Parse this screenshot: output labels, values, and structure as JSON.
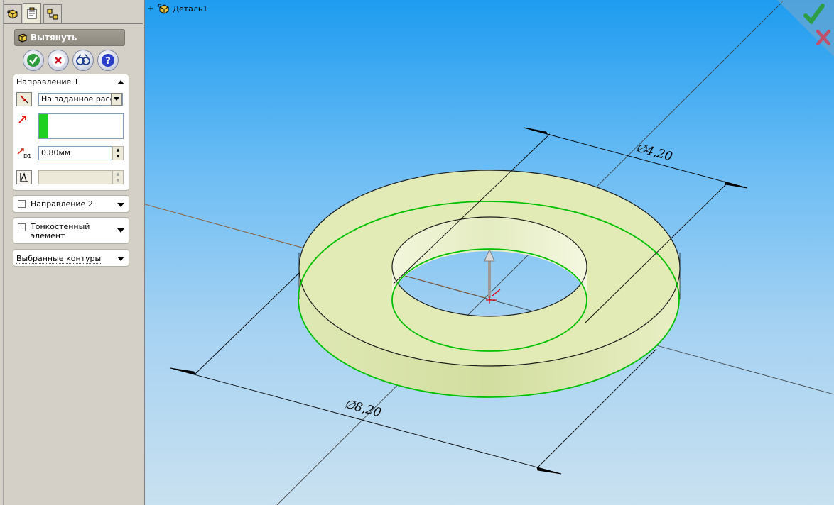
{
  "feature_manager": {
    "tabs": [
      {
        "icon": "feature-tree-icon"
      },
      {
        "icon": "property-manager-icon"
      },
      {
        "icon": "configuration-manager-icon"
      }
    ],
    "feature_title": "Вытянуть",
    "actions": [
      {
        "icon": "ok-check-icon"
      },
      {
        "icon": "cancel-x-icon"
      },
      {
        "icon": "preview-glasses-icon"
      },
      {
        "icon": "help-question-icon"
      }
    ]
  },
  "direction1": {
    "title": "Направление 1",
    "end_condition": "На заданное расст",
    "depth_value": "0.80мм",
    "draft_value": ""
  },
  "direction2": {
    "title": "Направление 2",
    "checked": false
  },
  "thin_feature": {
    "title": "Тонкостенный элемент",
    "checked": false
  },
  "selected_contours": {
    "title": "Выбранные контуры"
  },
  "viewport": {
    "tree_root": "Деталь1",
    "dimension_inner": "∅4,20",
    "dimension_outer": "∅8,20",
    "colors": {
      "sky_top": "#1e9cf0",
      "sky_bottom": "#c9e1f0",
      "part_fill": "#dfeab0",
      "sketch_green": "#00c000",
      "confirm_check": "#2e9e46",
      "confirm_x": "#c0506a"
    }
  }
}
